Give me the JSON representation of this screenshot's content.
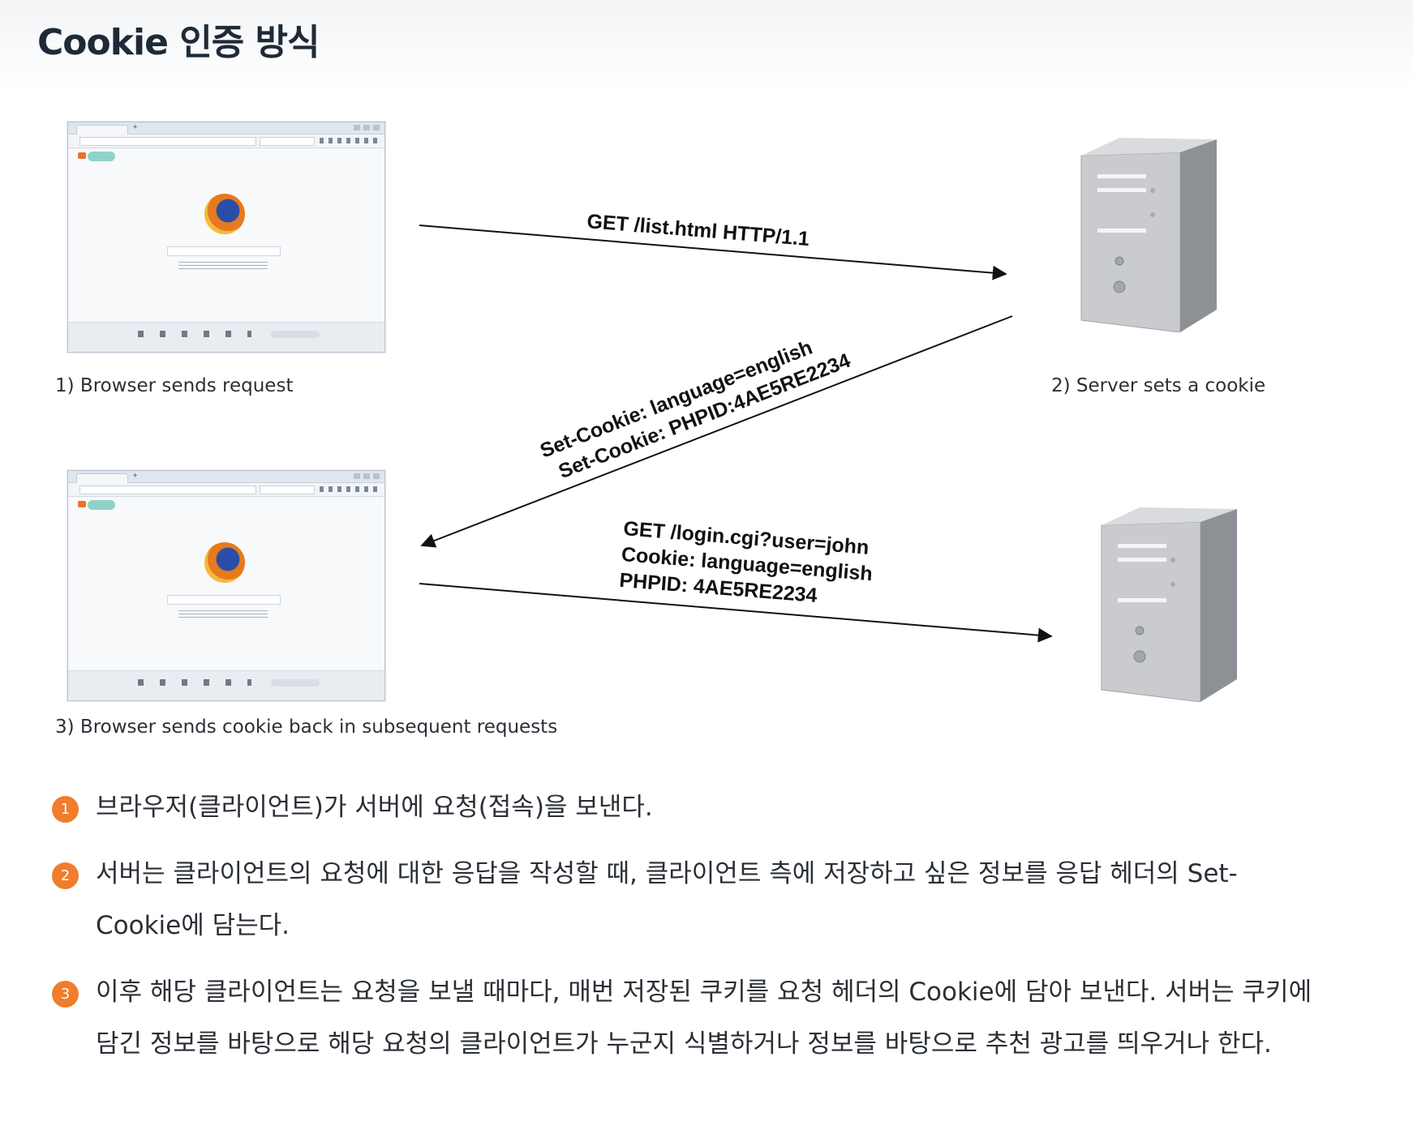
{
  "page": {
    "title": "Cookie 인증 방식"
  },
  "diagram": {
    "captions": {
      "browser_request": "1) Browser sends request",
      "server_sets": "2) Server sets a cookie",
      "browser_sends_back": "3) Browser sends cookie back in subsequent requests"
    },
    "request_1": {
      "line1": "GET /list.html HTTP/1.1"
    },
    "response": {
      "line1": "Set-Cookie: language=english",
      "line2": "Set-Cookie: PHPID:4AE5RE2234"
    },
    "request_2": {
      "line1": "GET /login.cgi?user=john",
      "line2": "Cookie: language=english",
      "line3": "PHPID: 4AE5RE2234"
    }
  },
  "steps": [
    {
      "number": "1",
      "text": "브라우저(클라이언트)가 서버에 요청(접속)을 보낸다."
    },
    {
      "number": "2",
      "text": "서버는 클라이언트의 요청에 대한 응답을 작성할 때, 클라이언트 측에 저장하고 싶은 정보를 응답 헤더의 Set-Cookie에 담는다."
    },
    {
      "number": "3",
      "text": "이후 해당 클라이언트는 요청을 보낼 때마다, 매번 저장된 쿠키를 요청 헤더의 Cookie에 담아 보낸다. 서버는 쿠키에 담긴 정보를 바탕으로 해당 요청의 클라이언트가 누군지 식별하거나 정보를 바탕으로 추천 광고를 띄우거나 한다."
    }
  ],
  "colors": {
    "accent": "#f07c2c",
    "server_front": "#c9cbce",
    "server_side": "#8d9095"
  }
}
